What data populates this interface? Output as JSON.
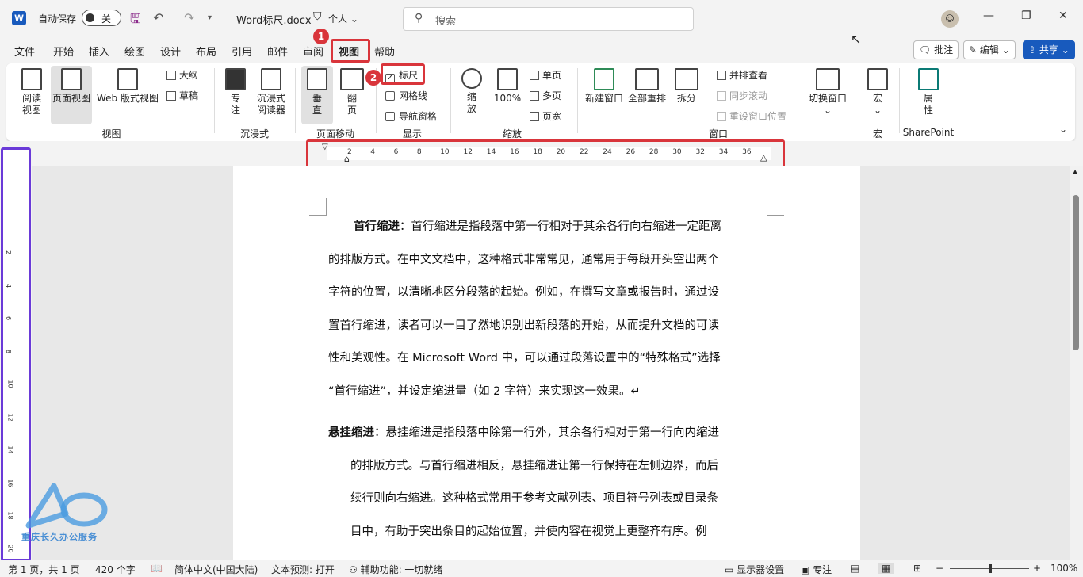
{
  "titlebar": {
    "autosave_label": "自动保存",
    "autosave_state": "关",
    "doc_name": "Word标尺.docx",
    "visibility": "个人",
    "search_placeholder": "搜索"
  },
  "menu": [
    "文件",
    "开始",
    "插入",
    "绘图",
    "设计",
    "布局",
    "引用",
    "邮件",
    "审阅",
    "视图",
    "帮助"
  ],
  "active_menu": "视图",
  "right_buttons": {
    "comment": "批注",
    "edit": "编辑",
    "share": "共享"
  },
  "annotations": {
    "badge1": "1",
    "badge2": "2"
  },
  "ribbon": {
    "views": {
      "read": "阅读\n视图",
      "print": "页面视图",
      "web": "Web 版式视图",
      "outline": "大纲",
      "draft": "草稿",
      "group": "视图"
    },
    "immersive": {
      "focus": "专\n注",
      "reader": "沉浸式\n阅读器",
      "group": "沉浸式"
    },
    "page_move": {
      "vertical": "垂\n直",
      "side": "翻\n页",
      "group": "页面移动"
    },
    "show": {
      "ruler": "标尺",
      "gridlines": "网格线",
      "nav": "导航窗格",
      "group": "显示"
    },
    "zoom": {
      "zoom": "缩\n放",
      "pct": "100%",
      "one": "单页",
      "multi": "多页",
      "width": "页宽",
      "group": "缩放"
    },
    "window": {
      "new": "新建窗口",
      "arrange": "全部重排",
      "split": "拆分",
      "side": "并排查看",
      "sync": "同步滚动",
      "reset": "重设窗口位置",
      "switch": "切换窗口",
      "group": "窗口"
    },
    "macro": {
      "macro": "宏",
      "group": "宏"
    },
    "sharepoint": {
      "props": "属\n性",
      "group": "SharePoint"
    }
  },
  "hruler_numbers": [
    "2",
    "4",
    "6",
    "8",
    "10",
    "12",
    "14",
    "16",
    "18",
    "20",
    "22",
    "24",
    "26",
    "28",
    "30",
    "32",
    "34",
    "36"
  ],
  "vruler_numbers": [
    "2",
    "4",
    "6",
    "8",
    "10",
    "12",
    "14",
    "16",
    "18",
    "20"
  ],
  "doc": {
    "p1_bold": "首行缩进",
    "p1_lines": [
      "：首行缩进是指段落中第一行相对于其余各行向右缩进一定距离",
      "的排版方式。在中文文档中，这种格式非常常见，通常用于每段开头空出两个",
      "字符的位置，以清晰地区分段落的起始。例如，在撰写文章或报告时，通过设",
      "置首行缩进，读者可以一目了然地识别出新段落的开始，从而提升文档的可读",
      "性和美观性。在 Microsoft Word 中，可以通过段落设置中的“特殊格式”选择",
      "“首行缩进”，并设定缩进量（如 2 字符）来实现这一效果。↵"
    ],
    "p2_bold": "悬挂缩进",
    "p2_lines": [
      "：悬挂缩进是指段落中除第一行外，其余各行相对于第一行向内缩进",
      "的排版方式。与首行缩进相反，悬挂缩进让第一行保持在左侧边界，而后",
      "续行则向右缩进。这种格式常用于参考文献列表、项目符号列表或目录条",
      "目中，有助于突出条目的起始位置，并使内容在视觉上更整齐有序。例"
    ]
  },
  "watermark": "重庆长久办公服务",
  "status": {
    "page": "第 1 页，共 1 页",
    "words": "420 个字",
    "lang": "简体中文(中国大陆)",
    "predict": "文本预测: 打开",
    "access": "辅助功能: 一切就绪",
    "display": "显示器设置",
    "focus": "专注",
    "zoom": "100%"
  }
}
